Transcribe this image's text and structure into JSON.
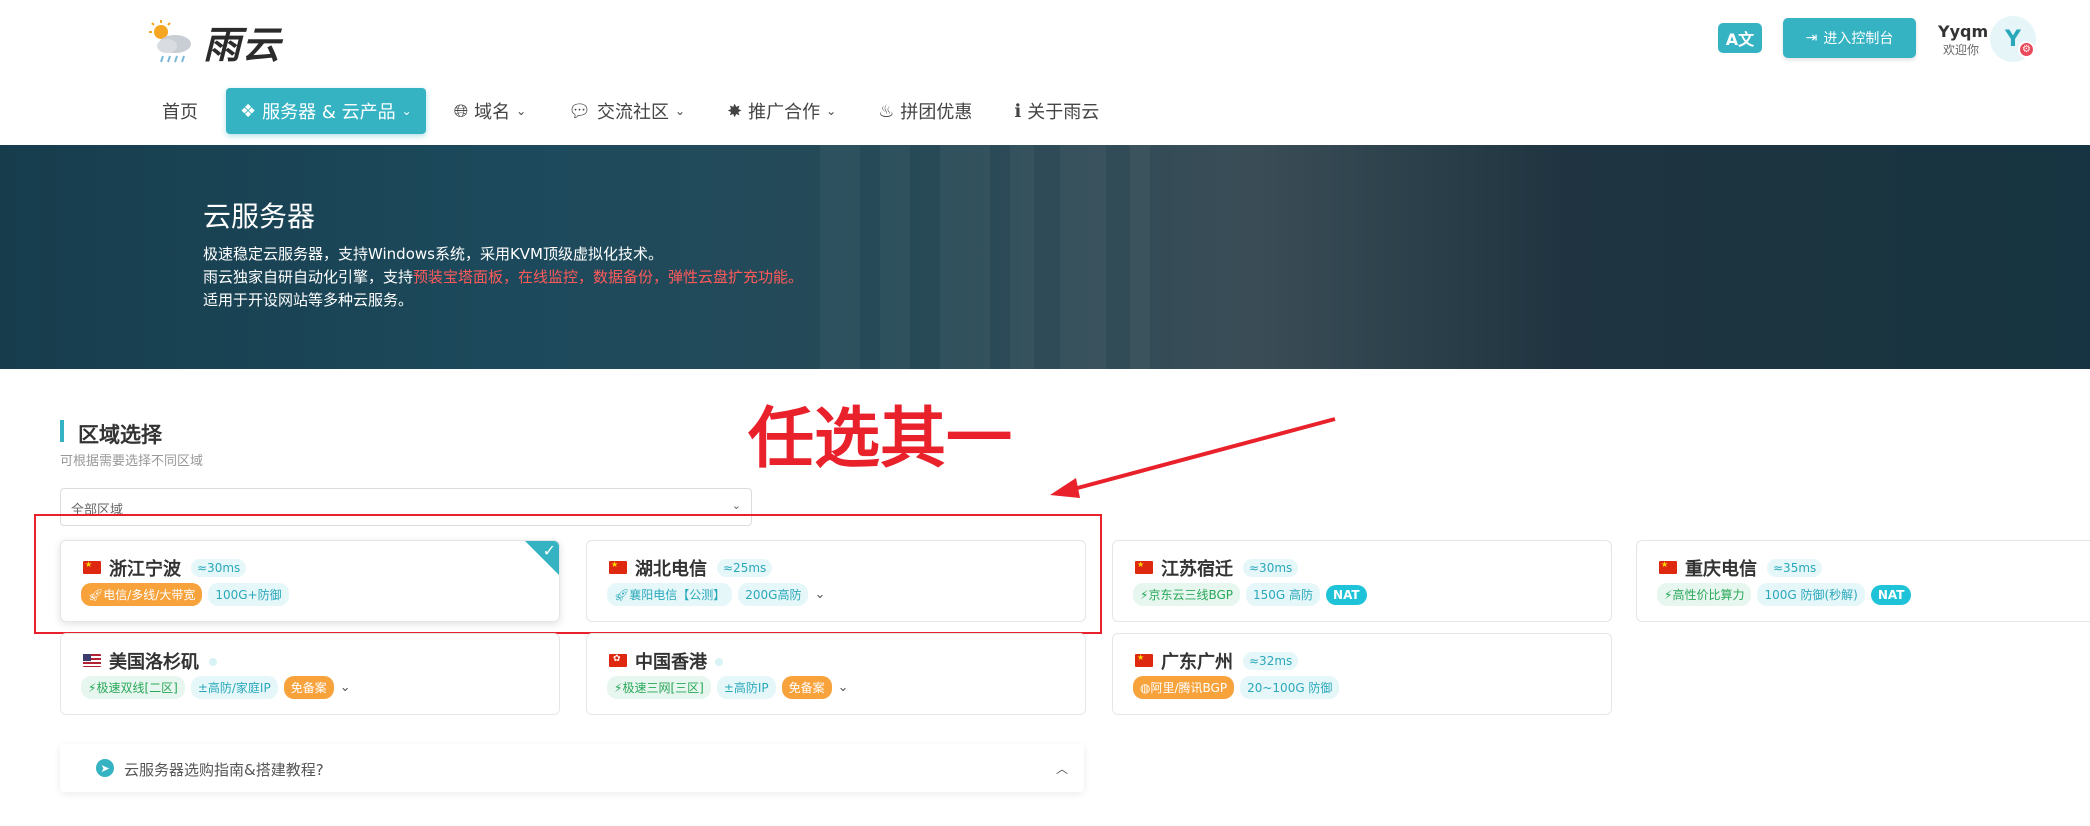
{
  "header": {
    "logo_text": "雨云",
    "lang_icon": "A文",
    "console_label": "进入控制台",
    "user_name": "Yyqm",
    "user_welcome": "欢迎你",
    "avatar_letter": "Y"
  },
  "nav": [
    {
      "label": "首页",
      "icon": "",
      "has_dropdown": false,
      "active": false
    },
    {
      "label": "服务器 & 云产品",
      "icon": "cubes-icon",
      "has_dropdown": true,
      "active": true
    },
    {
      "label": "域名",
      "icon": "globe-icon",
      "has_dropdown": true,
      "active": false
    },
    {
      "label": "交流社区",
      "icon": "comment-icon",
      "has_dropdown": true,
      "active": false
    },
    {
      "label": "推广合作",
      "icon": "handshake-icon",
      "has_dropdown": true,
      "active": false
    },
    {
      "label": "拼团优惠",
      "icon": "fire-icon",
      "has_dropdown": false,
      "active": false
    },
    {
      "label": "关于雨云",
      "icon": "info-icon",
      "has_dropdown": false,
      "active": false
    }
  ],
  "banner": {
    "title": "云服务器",
    "line1": "极速稳定云服务器，支持Windows系统，采用KVM顶级虚拟化技术。",
    "line2_prefix": "雨云独家自研自动化引擎，支持",
    "line2_highlight": "预装宝塔面板，在线监控，数据备份，弹性云盘扩充功能。",
    "line3": "适用于开设网站等多种云服务。"
  },
  "section": {
    "title": "区域选择",
    "subtitle": "可根据需要选择不同区域",
    "select_value": "全部区域"
  },
  "annotation": {
    "text": "任选其一"
  },
  "regions": [
    {
      "name": "浙江宁波",
      "ping": "≈30ms",
      "flag": "cn",
      "selected": true,
      "tags": [
        {
          "text": "电信/多线/大带宽",
          "style": "orange",
          "icon": "rocket-icon"
        },
        {
          "text": "100G+防御",
          "style": "teal"
        }
      ],
      "dropdown": false
    },
    {
      "name": "湖北电信",
      "ping": "≈25ms",
      "flag": "cn",
      "selected": false,
      "tags": [
        {
          "text": "襄阳电信【公测】",
          "style": "teal",
          "icon": "rocket-icon"
        },
        {
          "text": "200G高防",
          "style": "teal"
        }
      ],
      "dropdown": true
    },
    {
      "name": "江苏宿迁",
      "ping": "≈30ms",
      "flag": "cn",
      "selected": false,
      "tags": [
        {
          "text": "京东云三线BGP",
          "style": "green",
          "icon": "bolt-icon"
        },
        {
          "text": "150G 高防",
          "style": "teal"
        },
        {
          "text": "NAT",
          "style": "cyan"
        }
      ],
      "dropdown": false
    },
    {
      "name": "重庆电信",
      "ping": "≈35ms",
      "flag": "cn",
      "selected": false,
      "tags": [
        {
          "text": "高性价比算力",
          "style": "green",
          "icon": "bolt-icon"
        },
        {
          "text": "100G 防御(秒解)",
          "style": "teal"
        },
        {
          "text": "NAT",
          "style": "cyan"
        }
      ],
      "dropdown": false
    },
    {
      "name": "美国洛杉矶",
      "ping": "",
      "flag": "us",
      "selected": false,
      "tags": [
        {
          "text": "极速双线[二区]",
          "style": "green",
          "icon": "bolt-icon"
        },
        {
          "text": "±高防/家庭IP",
          "style": "teal"
        },
        {
          "text": "免备案",
          "style": "orange"
        }
      ],
      "dropdown": true
    },
    {
      "name": "中国香港",
      "ping": "",
      "flag": "hk",
      "selected": false,
      "tags": [
        {
          "text": "极速三网[三区]",
          "style": "green",
          "icon": "bolt-icon"
        },
        {
          "text": "±高防IP",
          "style": "teal"
        },
        {
          "text": "免备案",
          "style": "orange"
        }
      ],
      "dropdown": true
    },
    {
      "name": "广东广州",
      "ping": "≈32ms",
      "flag": "cn",
      "selected": false,
      "tags": [
        {
          "text": "阿里/腾讯BGP",
          "style": "orange",
          "icon": "globe-icon"
        },
        {
          "text": "20~100G 防御",
          "style": "teal"
        }
      ],
      "dropdown": false
    }
  ],
  "guide": {
    "text": "云服务器选购指南&搭建教程?"
  },
  "colors": {
    "accent": "#36b3c3",
    "annotation_red": "#e8212b",
    "highlight_red": "#ff5a5a"
  }
}
